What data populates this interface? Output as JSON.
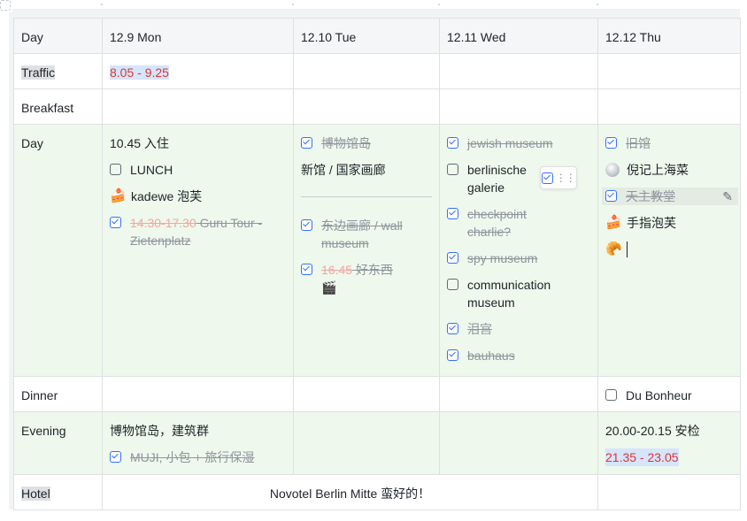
{
  "columns": {
    "label": "Day",
    "days": [
      "12.9 Mon",
      "12.10 Tue",
      "12.11 Wed",
      "12.12 Thu"
    ]
  },
  "rows": {
    "traffic": {
      "label": "Traffic",
      "mon": "8.05 - 9.25"
    },
    "breakfast": {
      "label": "Breakfast"
    },
    "day": {
      "label": "Day",
      "mon": {
        "checkin": "10.45 入住",
        "lunch": "LUNCH",
        "kadewe": "kadewe 泡芙",
        "tour_time": "14.30-17.30",
        "tour_text": " Guru Tour - Zietenplatz"
      },
      "tue": {
        "museum_island": "博物馆岛",
        "new_gallery": "新馆 / 国家画廊",
        "east_side": "东边画廊 / wall museum",
        "goods_time": "16.45",
        "goods_text": " 好东西"
      },
      "wed": {
        "jewish": "jewish museum",
        "berlinische": "berlinische galerie",
        "checkpoint": "checkpoint charlie?",
        "spy": "spy museum",
        "communication": "communication museum",
        "lei_gong": "泪宫",
        "bauhaus": "bauhaus"
      },
      "thu": {
        "old_museum": "旧馆",
        "shanghai_food": "倪记上海菜",
        "cathedral": "天主教堂",
        "finger_puff": "手指泡芙"
      }
    },
    "dinner": {
      "label": "Dinner",
      "thu": "Du Bonheur"
    },
    "evening": {
      "label": "Evening",
      "mon_text": "博物馆岛，建筑群",
      "mon_muji": "MUJI, 小包 + 旅行保湿",
      "thu_security": "20.00-20.15 安检",
      "thu_time": "21.35 - 23.05"
    },
    "hotel": {
      "label": "Hotel",
      "value": "Novotel Berlin Mitte 蛮好的！"
    }
  },
  "icons": {
    "cake": "🍰",
    "clapper": "🎬",
    "croissant": "🥐",
    "pearl": "pearl-icon",
    "edit": "edit-icon",
    "drag": "drag-handle-icon"
  },
  "colors": {
    "header_bg": "#f5f6f7",
    "green_row_bg": "#eef8ec",
    "checkbox_blue": "#3370ff",
    "time_red": "#d83931",
    "time_highlight": "#d6e4fd"
  }
}
